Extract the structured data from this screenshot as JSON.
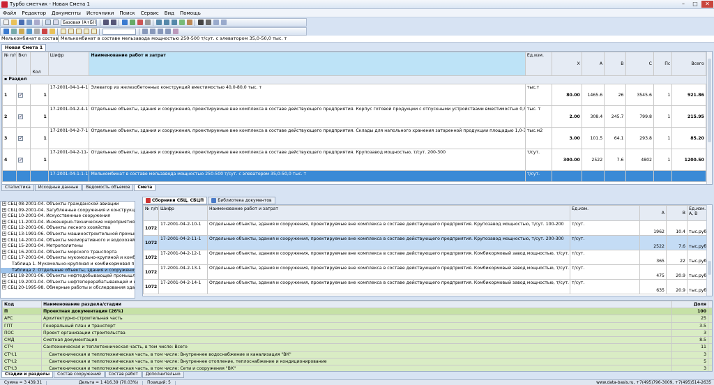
{
  "window": {
    "title": "Турбо сметчик - Новая Смета 1"
  },
  "menu": [
    "Файл",
    "Редактор",
    "Документы",
    "Источники",
    "Поиск",
    "Сервис",
    "Вид",
    "Помощь"
  ],
  "toolbar": {
    "font_combo": "Базовая (А+Б)(К)",
    "combo2": ""
  },
  "path": {
    "left": "Мелькомбинат в составе з",
    "right": "Мелькомбинат в составе мельзавода мощностью 250-500 т/сут. с элеватором 35,0-50,0 тыс. т"
  },
  "doc_tab": "Новая Смета 1",
  "estimate": {
    "headers": {
      "num": "№ п/п",
      "vkl": "Вкл",
      "kol": "Кол",
      "shifr": "Шифр",
      "name": "Наименование работ и затрат",
      "unit": "Ед.изм.",
      "x": "X",
      "a": "A",
      "b": "B",
      "c": "C",
      "pc": "Пс",
      "total": "Всего"
    },
    "section_label": "Раздел",
    "rows": [
      {
        "n": "1",
        "kol": "1",
        "shifr": "17-2001-04-1-4-1",
        "name": "Элеватор из железобетонных конструкций вместимостью 40,0-80,0 тыс. т",
        "unit": "тыс.т",
        "x": "80.00",
        "a": "1465.6",
        "b": "26",
        "c": "3545.6",
        "pc": "1",
        "total": "921.86"
      },
      {
        "n": "2",
        "kol": "1",
        "shifr": "17-2001-04-2-4-1",
        "name": "Отдельные объекты, здания и сооружения, проектируемые вне комплекса в составе действующего предприятия. Корпус готовой продукции с отпускными устройствами вместимостью 0,5-2,0 тыс. т",
        "unit": "тыс. т",
        "x": "2.00",
        "a": "308.4",
        "b": "245.7",
        "c": "799.8",
        "pc": "1",
        "total": "215.95"
      },
      {
        "n": "3",
        "kol": "1",
        "shifr": "17-2001-04-2-7-1",
        "name": "Отдельные объекты, здания и сооружения, проектируемые вне комплекса в составе действующего предприятия. Склады для напольного хранения затаренной продукции площадью 1,0-3,0 тыс.м2",
        "unit": "тыс.м2",
        "x": "3.00",
        "a": "101.5",
        "b": "64.1",
        "c": "293.8",
        "pc": "1",
        "total": "85.20"
      },
      {
        "n": "4",
        "kol": "1",
        "shifr": "17-2001-04-2-11-1",
        "name": "Отдельные объекты, здания и сооружения, проектируемые вне комплекса в составе действующего предприятия. Крупозавод мощностью, т/сут. 200-300",
        "unit": "т/сут.",
        "x": "300.00",
        "a": "2522",
        "b": "7.6",
        "c": "4802",
        "pc": "1",
        "total": "1200.50"
      },
      {
        "n": "",
        "kol": "",
        "shifr": "17-2001-04-1-1-1",
        "name": "Мелькомбинат в составе мельзавода мощностью 250-500 т/сут. с элеватором 35,0-50,0 тыс. т",
        "unit": "т/сут.",
        "x": "",
        "a": "",
        "b": "",
        "c": "",
        "pc": "",
        "total": ""
      }
    ]
  },
  "bottom_tabs": [
    "Статистика",
    "Исходные данные",
    "Ведомость объемов",
    "Смета"
  ],
  "tree": [
    {
      "t": "СБЦ 08-2001-04. Объекты гражданской авиации",
      "pm": "+"
    },
    {
      "t": "СБЦ 09-2001-04. Загубленные сооружения и конструкции",
      "pm": "+"
    },
    {
      "t": "СБЦ 10-2001-04. Искусственные сооружения",
      "pm": "+"
    },
    {
      "t": "СБЦ 11-2001-04. Инженерно-технические мероприятия гражд",
      "pm": "+"
    },
    {
      "t": "СБЦ 12-2001-06. Объекты лесного хозяйства",
      "pm": "+"
    },
    {
      "t": "СБЦ 13-1991-06. Объекты машиностроительной промышленн",
      "pm": "+"
    },
    {
      "t": "СБЦ 14-2001-04. Объекты мелиоративного и водохозяйствен",
      "pm": "+"
    },
    {
      "t": "СБЦ 15-2001-04. Метрополитены",
      "pm": "+"
    },
    {
      "t": "СБЦ 16-2001-04. Объекты морского транспорта",
      "pm": "+"
    },
    {
      "t": "СБЦ 17-2001-04. Объекты мукомольно-крупяной и комбикорм",
      "pm": "-"
    },
    {
      "t": "Таблица 1. Мукомольно-крупяная и комбикормовая пром",
      "pm": ""
    },
    {
      "t": "Таблица 2. Отдельные объекты, здания и сооружения, пр",
      "pm": "",
      "hl": true
    },
    {
      "t": "СБЦ 18-2001-06. Объекты нефтедобывающей промышленности",
      "pm": "+"
    },
    {
      "t": "СБЦ 19-2001-04. Объекты нефтеперерабатывающей и нефтехи",
      "pm": "+"
    },
    {
      "t": "СБЦ 20-1995-98. Обмерные работы и обследования зданий и",
      "pm": "+"
    }
  ],
  "ref_tabs": [
    "Сборники СБЦ, СБЦП",
    "Библиотека документов"
  ],
  "ref": {
    "headers": {
      "n": "№ п/п",
      "shifr": "Шифр",
      "name": "Наименование работ и затрат",
      "unit": "Ед.изм.",
      "a": "A",
      "b": "B",
      "unit2": "Ед.изм. А, В"
    },
    "rows": [
      {
        "n": "1072",
        "shifr": "17-2001-04-2-10-1",
        "name": "Отдельные объекты, здания и сооружения, проектируемые вне комплекса в составе действующего предприятия. Крупозавод мощностью, т/сут. 100-200",
        "unit": "т/сут.",
        "a": "1962",
        "b": "10.4",
        "u2": "тыс.руб."
      },
      {
        "n": "1072",
        "shifr": "17-2001-04-2-11-1",
        "name": "Отдельные объекты, здания и сооружения, проектируемые вне комплекса в составе действующего предприятия. Крупозавод мощностью, т/сут. 200-300",
        "unit": "т/сут.",
        "a": "2522",
        "b": "7.6",
        "u2": "тыс.руб."
      },
      {
        "n": "1072",
        "shifr": "17-2001-04-2-12-1",
        "name": "Отдельные объекты, здания и сооружения, проектируемые вне комплекса в составе действующего предприятия. Комбикормовый завод мощностью, т/сут. 25-100",
        "unit": "т/сут.",
        "a": "365",
        "b": "22",
        "u2": "тыс.руб."
      },
      {
        "n": "1072",
        "shifr": "17-2001-04-2-13-1",
        "name": "Отдельные объекты, здания и сооружения, проектируемые вне комплекса в составе действующего предприятия. Комбикормовый завод мощностью, т/сут. 100-200",
        "unit": "т/сут.",
        "a": "475",
        "b": "20.9",
        "u2": "тыс.руб."
      },
      {
        "n": "1072",
        "shifr": "17-2001-04-2-14-1",
        "name": "Отдельные объекты, здания и сооружения, проектируемые вне комплекса в составе действующего предприятия. Комбикормовый завод мощностью, т/сут. 200-320",
        "unit": "т/сут.",
        "a": "635",
        "b": "20.9",
        "u2": "тыс.руб."
      }
    ]
  },
  "stages": {
    "headers": {
      "code": "Код",
      "name": "Наименование раздела/стадии",
      "share": "Доля"
    },
    "rows": [
      {
        "code": "П",
        "name": "Проектная документация (26%)",
        "share": "100",
        "p": true
      },
      {
        "code": "АРС",
        "name": "Архитектурно-строительная часть",
        "share": "25"
      },
      {
        "code": "ГПТ",
        "name": "Генеральный план и транспорт",
        "share": "3.5"
      },
      {
        "code": "ПОС",
        "name": "Проект организации строительства",
        "share": "3"
      },
      {
        "code": "СМД",
        "name": "Сметная документация",
        "share": "8.5"
      },
      {
        "code": "СТЧ",
        "name": "Сантехническая и теплотехническая часть, в том числе: Всего",
        "share": "11"
      },
      {
        "code": "СТЧ.1",
        "name": "Сантехническая и теплотехническая часть, в том числе: Внутреннее водоснабжение и канализация \"ВК\"",
        "share": "3",
        "ind": true
      },
      {
        "code": "СТЧ.2",
        "name": "Сантехническая и теплотехническая часть, в том числе: Внутреннее отопление, теплоснабжение и кондиционирование",
        "share": "5",
        "ind": true
      },
      {
        "code": "СТЧ.3",
        "name": "Сантехническая и теплотехническая часть, в том числе: Сети и сооружения \"ВК\"",
        "share": "3",
        "ind": true
      }
    ]
  },
  "stage_tabs": [
    "Стадии и разделы",
    "Состав сооружений",
    "Состав работ",
    "Дополнительно"
  ],
  "status": {
    "sum": "Сумма = 3 439.31",
    "delta": "Дельта = 1 416.39 (70.03%)",
    "pos": "Позиций: 5",
    "contacts": "www.data-basis.ru, +7(495)796-3009, +7(495)514-2635"
  },
  "colors": {
    "selection": "#3a8ad6",
    "header_blue": "#bde3f7",
    "stage_green": "#d9ecc4"
  }
}
